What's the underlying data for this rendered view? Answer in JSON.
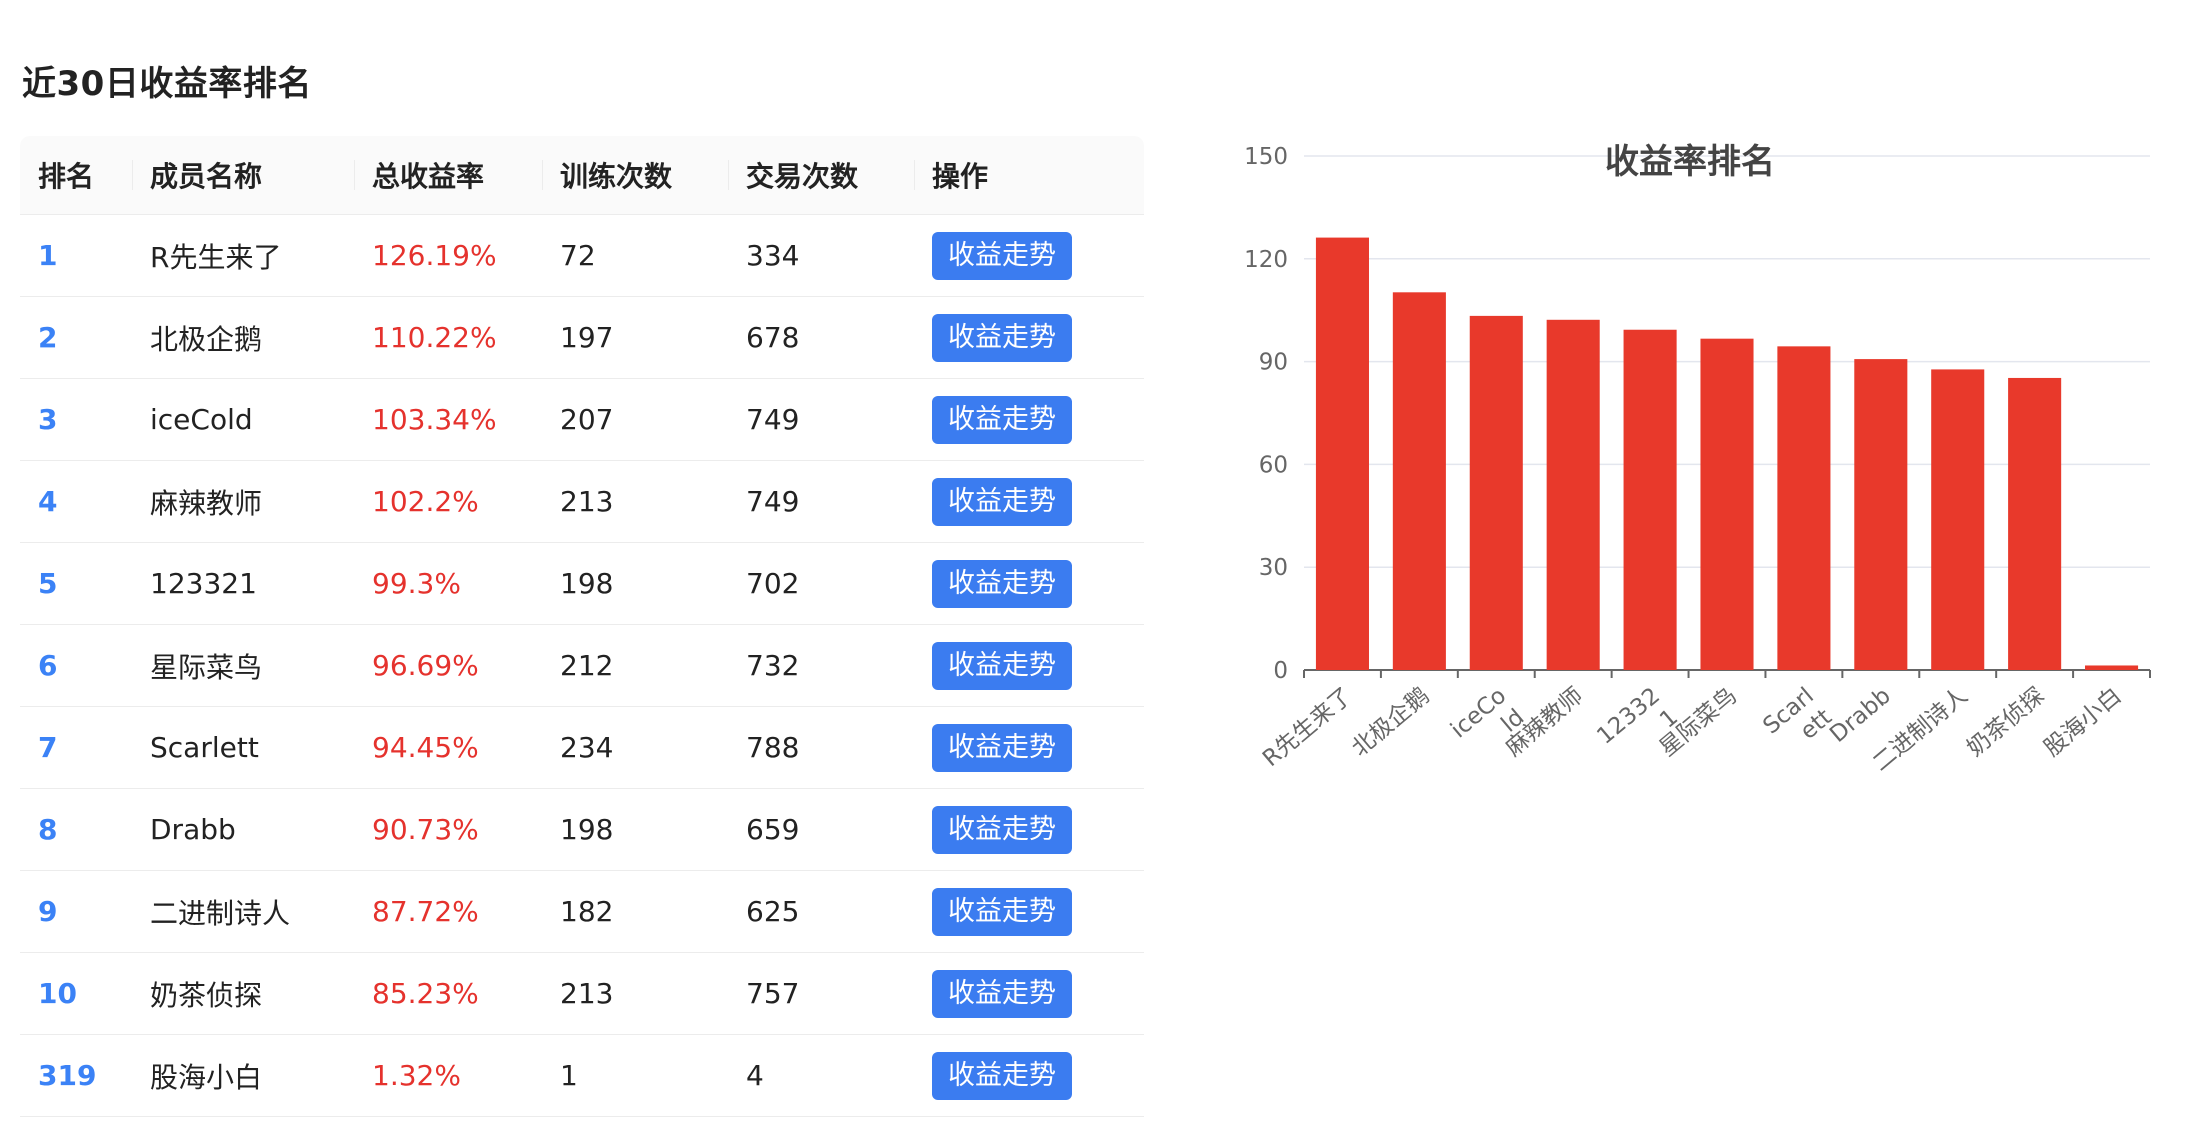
{
  "section_title": "近30日收益率排名",
  "table": {
    "headers": [
      "排名",
      "成员名称",
      "总收益率",
      "训练次数",
      "交易次数",
      "操作"
    ],
    "action_label": "收益走势",
    "rows": [
      {
        "rank": "1",
        "name": "R先生来了",
        "rate": "126.19%",
        "train": "72",
        "trade": "334"
      },
      {
        "rank": "2",
        "name": "北极企鹅",
        "rate": "110.22%",
        "train": "197",
        "trade": "678"
      },
      {
        "rank": "3",
        "name": "iceCold",
        "rate": "103.34%",
        "train": "207",
        "trade": "749"
      },
      {
        "rank": "4",
        "name": "麻辣教师",
        "rate": "102.2%",
        "train": "213",
        "trade": "749"
      },
      {
        "rank": "5",
        "name": "123321",
        "rate": "99.3%",
        "train": "198",
        "trade": "702"
      },
      {
        "rank": "6",
        "name": "星际菜鸟",
        "rate": "96.69%",
        "train": "212",
        "trade": "732"
      },
      {
        "rank": "7",
        "name": "Scarlett",
        "rate": "94.45%",
        "train": "234",
        "trade": "788"
      },
      {
        "rank": "8",
        "name": "Drabb",
        "rate": "90.73%",
        "train": "198",
        "trade": "659"
      },
      {
        "rank": "9",
        "name": "二进制诗人",
        "rate": "87.72%",
        "train": "182",
        "trade": "625"
      },
      {
        "rank": "10",
        "name": "奶茶侦探",
        "rate": "85.23%",
        "train": "213",
        "trade": "757"
      },
      {
        "rank": "319",
        "name": "股海小白",
        "rate": "1.32%",
        "train": "1",
        "trade": "4"
      }
    ]
  },
  "colors": {
    "rank": "#3b82f6",
    "rate": "#e5322d",
    "button": "#3b7cf0",
    "bar": "#e8392b",
    "grid": "#e3e6ee"
  },
  "chart_data": {
    "type": "bar",
    "title": "收益率排名",
    "categories": [
      "R先生来了",
      "北极企鹅",
      "iceCold",
      "麻辣教师",
      "123321",
      "星际菜鸟",
      "Scarlett",
      "Drabb",
      "二进制诗人",
      "奶茶侦探",
      "股海小白"
    ],
    "category_lines": [
      [
        "R先生来了"
      ],
      [
        "北极企鹅"
      ],
      [
        "iceCo",
        "ld"
      ],
      [
        "麻辣教师"
      ],
      [
        "12332",
        "1"
      ],
      [
        "星际菜鸟"
      ],
      [
        "Scarl",
        "ett"
      ],
      [
        "Drabb"
      ],
      [
        "二进制诗人"
      ],
      [
        "奶茶侦探"
      ],
      [
        "股海小白"
      ]
    ],
    "values": [
      126.19,
      110.22,
      103.34,
      102.2,
      99.3,
      96.69,
      94.45,
      90.73,
      87.72,
      85.23,
      1.32
    ],
    "yticks": [
      "0",
      "30",
      "60",
      "90",
      "120",
      "150"
    ],
    "ylim": [
      0,
      150
    ],
    "grid": true
  }
}
